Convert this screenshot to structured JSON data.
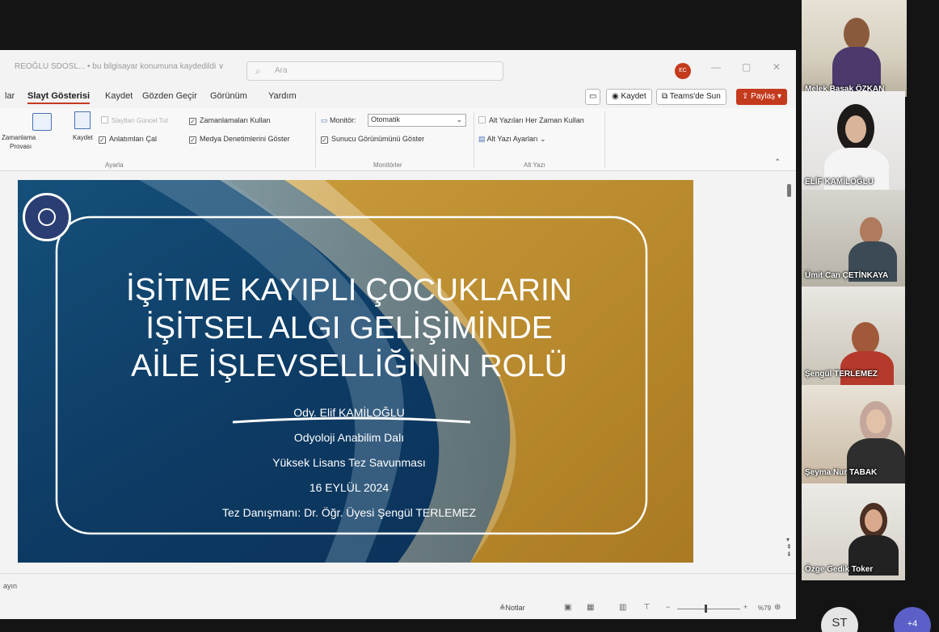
{
  "window": {
    "doc_title": "REOĞLU SDOSL... • bu bilgisayar konumuna kaydedildi ∨",
    "search_placeholder": "Ara",
    "avatar_initials": "EC"
  },
  "menu": {
    "items": [
      "lar",
      "Slayt Gösterisi",
      "Kaydet",
      "Gözden Geçir",
      "Görünüm",
      "Yardım"
    ],
    "record_label": "Kaydet",
    "teams_label": "Teams'de Sun",
    "share_label": "Paylaş"
  },
  "ribbon": {
    "rehearse_label": "Zamanlama",
    "rehearse_label2": "Provası",
    "record_label": "Kaydet",
    "hide_slide": "Slaytları Güncel Tut",
    "play_narrations": "Anlatımları Çal",
    "use_timings": "Zamanlamaları Kullan",
    "show_media_controls": "Medya Denetimlerini Göster",
    "group_setup": "Ayarla",
    "monitor_label": "Monitör:",
    "monitor_value": "Otomatik",
    "presenter_view": "Sunucu Görünümünü Göster",
    "group_monitors": "Monitörler",
    "always_subtitles": "Alt Yazıları Her Zaman Kullan",
    "subtitle_settings": "Alt Yazı Ayarları",
    "group_captions": "Alt Yazı"
  },
  "slide": {
    "title_lines": [
      "İŞİTME KAYIPLI ÇOCUKLARIN",
      "İŞİTSEL ALGI GELİŞİMİNDE",
      "AİLE İŞLEVSELLİĞİNİN ROLÜ"
    ],
    "author": "Ody. Elif KAMİLOĞLU",
    "department": "Odyoloji Anabilim Dalı",
    "degree": "Yüksek Lisans Tez Savunması",
    "date": "16  EYLÜL 2024",
    "advisor": "Tez Danışmanı: Dr. Öğr. Üyesi Şengül TERLEMEZ"
  },
  "status": {
    "left_text": "ayın",
    "notes_label": "Notlar",
    "zoom": "%79"
  },
  "participants": [
    {
      "name": "Melek Başak ÖZKAN"
    },
    {
      "name": "ELİF KAMİLOĞLU"
    },
    {
      "name": "Ümit Can ÇETİNKAYA"
    },
    {
      "name": "Şengül TERLEMEZ"
    },
    {
      "name": "Şeyma Nur TABAK"
    },
    {
      "name": "Özge Gedik Toker"
    }
  ],
  "overflow": {
    "initials": "ST",
    "more": "+4"
  },
  "colors": {
    "slide_blue": "#0d3a63",
    "slide_gold": "#b98a2c",
    "accent_red": "#c43a1d",
    "teams_purple": "#5b5fc7"
  }
}
